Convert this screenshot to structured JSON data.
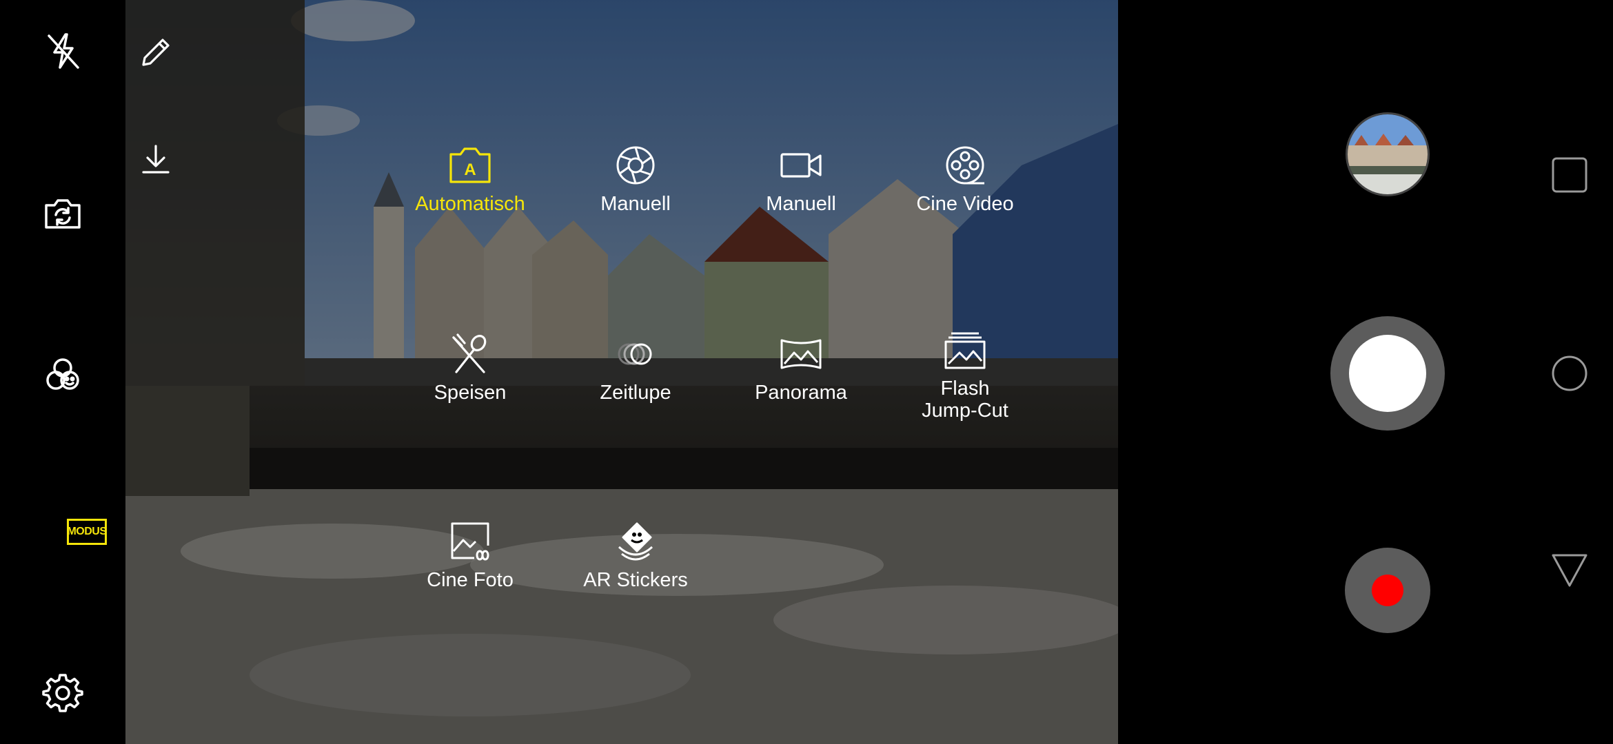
{
  "colors": {
    "accent": "#f5e50a",
    "record": "#ff0000",
    "panel": "#000000",
    "button_ring": "#5c5c5c"
  },
  "left_rail": {
    "flash_icon": "flash-off-icon",
    "switch_camera_icon": "switch-camera-icon",
    "filter_icon": "beauty-filter-icon",
    "mode_badge": "MODUS",
    "settings_icon": "gear-icon"
  },
  "viewfinder_tools": {
    "edit_icon": "pencil-icon",
    "download_icon": "download-icon"
  },
  "modes": [
    {
      "label": "Automatisch",
      "icon": "camera-auto-icon",
      "active": true
    },
    {
      "label": "Manuell",
      "icon": "aperture-icon",
      "active": false
    },
    {
      "label": "Manuell",
      "icon": "video-camera-icon",
      "active": false
    },
    {
      "label": "Cine Video",
      "icon": "film-reel-icon",
      "active": false
    },
    {
      "label": "Speisen",
      "icon": "fork-spoon-icon",
      "active": false
    },
    {
      "label": "Zeitlupe",
      "icon": "slow-motion-icon",
      "active": false
    },
    {
      "label": "Panorama",
      "icon": "panorama-icon",
      "active": false
    },
    {
      "label": "Flash\nJump-Cut",
      "icon": "stacked-photos-icon",
      "active": false
    },
    {
      "label": "Cine Foto",
      "icon": "cine-photo-icon",
      "active": false
    },
    {
      "label": "AR Stickers",
      "icon": "ar-sticker-icon",
      "active": false
    }
  ],
  "right_panel": {
    "gallery_thumb": "gallery-thumbnail",
    "shutter": "shutter-button",
    "record": "record-button"
  },
  "nav_bar": {
    "recents_icon": "square-recents-icon",
    "home_icon": "circle-home-icon",
    "back_icon": "triangle-back-icon"
  }
}
